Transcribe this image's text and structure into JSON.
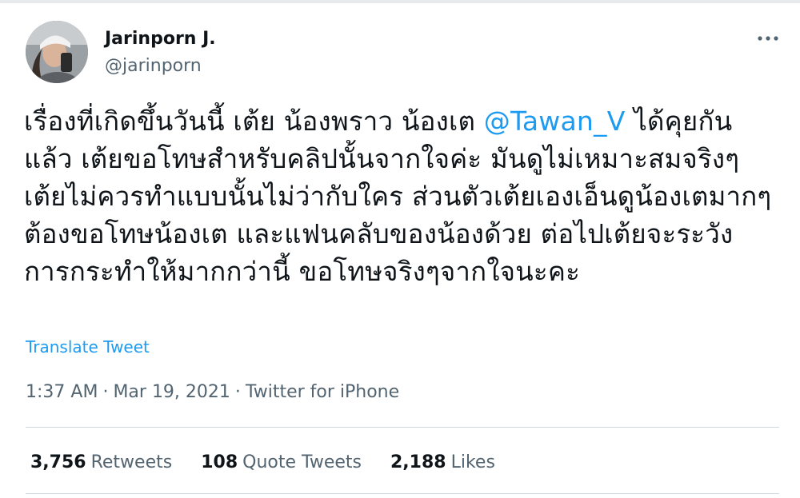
{
  "author": {
    "name": "Jarinporn J.",
    "handle": "@jarinporn"
  },
  "tweet": {
    "text_before": "เรื่องที่เกิดขึ้นวันนี้ เต้ย น้องพราว น้องเต ",
    "mention": "@Tawan_V",
    "text_after": " ได้คุยกันแล้ว เต้ยขอโทษสำหรับคลิปนั้นจากใจค่ะ มันดูไม่เหมาะสมจริงๆ เต้ยไม่ควรทำแบบนั้นไม่ว่ากับใคร ส่วนตัวเต้ยเองเอ็นดูน้องเตมากๆ ต้องขอโทษน้องเต และแฟนคลับของน้องด้วย ต่อไปเต้ยจะระวังการกระทำให้มากกว่านี้ ขอโทษจริงๆจากใจนะคะ",
    "translate_label": "Translate Tweet"
  },
  "meta": {
    "time": "1:37 AM",
    "separator": "·",
    "date": "Mar 19, 2021",
    "source": "Twitter for iPhone"
  },
  "stats": {
    "retweets_count": "3,756",
    "retweets_label": "Retweets",
    "quotes_count": "108",
    "quotes_label": "Quote Tweets",
    "likes_count": "2,188",
    "likes_label": "Likes"
  },
  "icons": {
    "more": "more-dots-icon",
    "avatar": "profile-photo"
  },
  "colors": {
    "link": "#1d9bf0",
    "secondary_text": "#536471",
    "primary_text": "#0f1419",
    "divider": "#cfd9de"
  }
}
